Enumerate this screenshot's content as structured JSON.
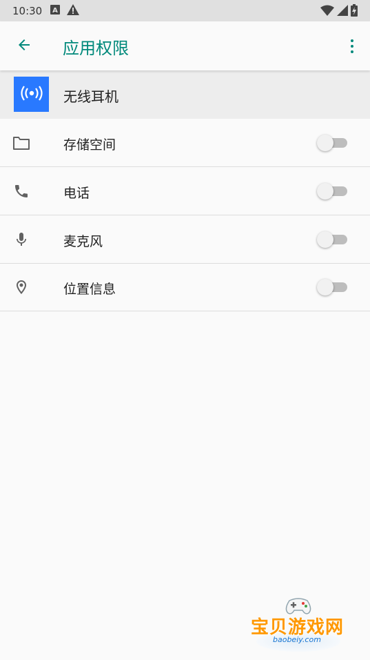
{
  "status_bar": {
    "time": "10:30",
    "left_icons": [
      "a-box-icon",
      "warning-icon"
    ],
    "right_icons": [
      "wifi-icon",
      "signal-icon",
      "battery-charging-icon"
    ]
  },
  "app_bar": {
    "title": "应用权限",
    "accent_color": "#00897b"
  },
  "app_header": {
    "app_name": "无线耳机",
    "icon_bg_color": "#2979ff",
    "icon": "broadcast-icon"
  },
  "permissions": [
    {
      "label": "存储空间",
      "icon": "folder-icon",
      "enabled": false
    },
    {
      "label": "电话",
      "icon": "phone-icon",
      "enabled": false
    },
    {
      "label": "麦克风",
      "icon": "microphone-icon",
      "enabled": false
    },
    {
      "label": "位置信息",
      "icon": "location-icon",
      "enabled": false
    }
  ],
  "watermark": {
    "text": "宝贝游戏网",
    "url": "baobeiy.com"
  }
}
